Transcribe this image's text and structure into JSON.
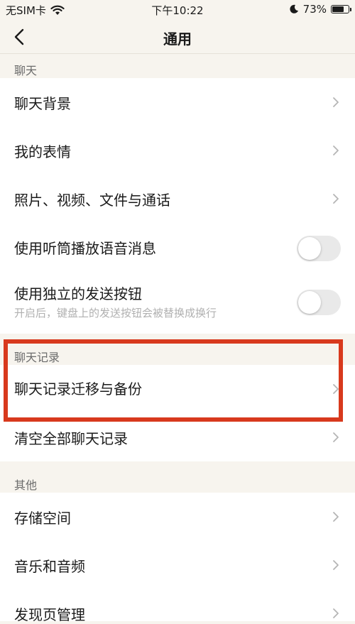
{
  "status_bar": {
    "carrier": "无SIM卡",
    "time": "下午10:22",
    "battery": "73%",
    "battery_level": 0.73
  },
  "nav": {
    "title": "通用",
    "back_icon": "chevron-left-icon"
  },
  "sections": {
    "chat": {
      "header": "聊天",
      "items": [
        {
          "label": "聊天背景"
        },
        {
          "label": "我的表情"
        },
        {
          "label": "照片、视频、文件与通话"
        },
        {
          "label": "使用听筒播放语音消息",
          "toggle": false
        },
        {
          "label": "使用独立的发送按钮",
          "sublabel": "开启后，键盘上的发送按钮会被替换成换行",
          "toggle": false
        }
      ]
    },
    "history": {
      "header": "聊天记录",
      "items": [
        {
          "label": "聊天记录迁移与备份"
        },
        {
          "label": "清空全部聊天记录"
        }
      ]
    },
    "other": {
      "header": "其他",
      "items": [
        {
          "label": "存储空间"
        },
        {
          "label": "音乐和音频"
        },
        {
          "label": "发现页管理"
        }
      ]
    }
  },
  "colors": {
    "highlight": "#d8391d",
    "page_bg": "#f7f4ee",
    "row_bg": "#ffffff"
  }
}
